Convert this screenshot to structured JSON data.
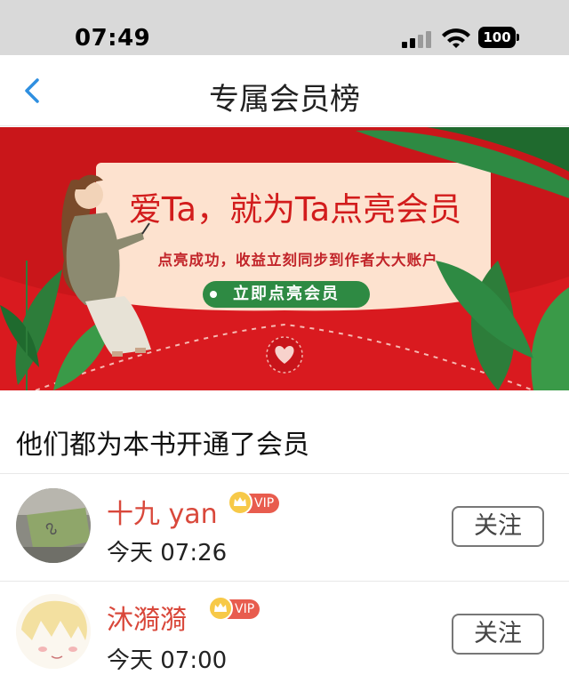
{
  "status_bar": {
    "time": "07:49",
    "battery": "100"
  },
  "nav": {
    "title": "专属会员榜",
    "back_icon": "chevron-left-icon"
  },
  "banner": {
    "headline": "爱Ta，就为Ta点亮会员",
    "subtext": "点亮成功，收益立刻同步到作者大大账户",
    "cta_label": "立即点亮会员",
    "colors": {
      "background": "#c9161a",
      "paper": "#fde2cf",
      "leaf": "#2e8a43",
      "headline": "#d21c1c"
    }
  },
  "section": {
    "title": "他们都为本书开通了会员"
  },
  "members": [
    {
      "name": "十九 yan",
      "badge": "VIP",
      "time": "今天 07:26",
      "follow_label": "关注"
    },
    {
      "name": "沐漪漪",
      "badge": "VIP",
      "time": "今天 07:00",
      "follow_label": "关注"
    }
  ],
  "colors": {
    "name": "#d9483b",
    "vip_badge": "#e85c4e"
  }
}
